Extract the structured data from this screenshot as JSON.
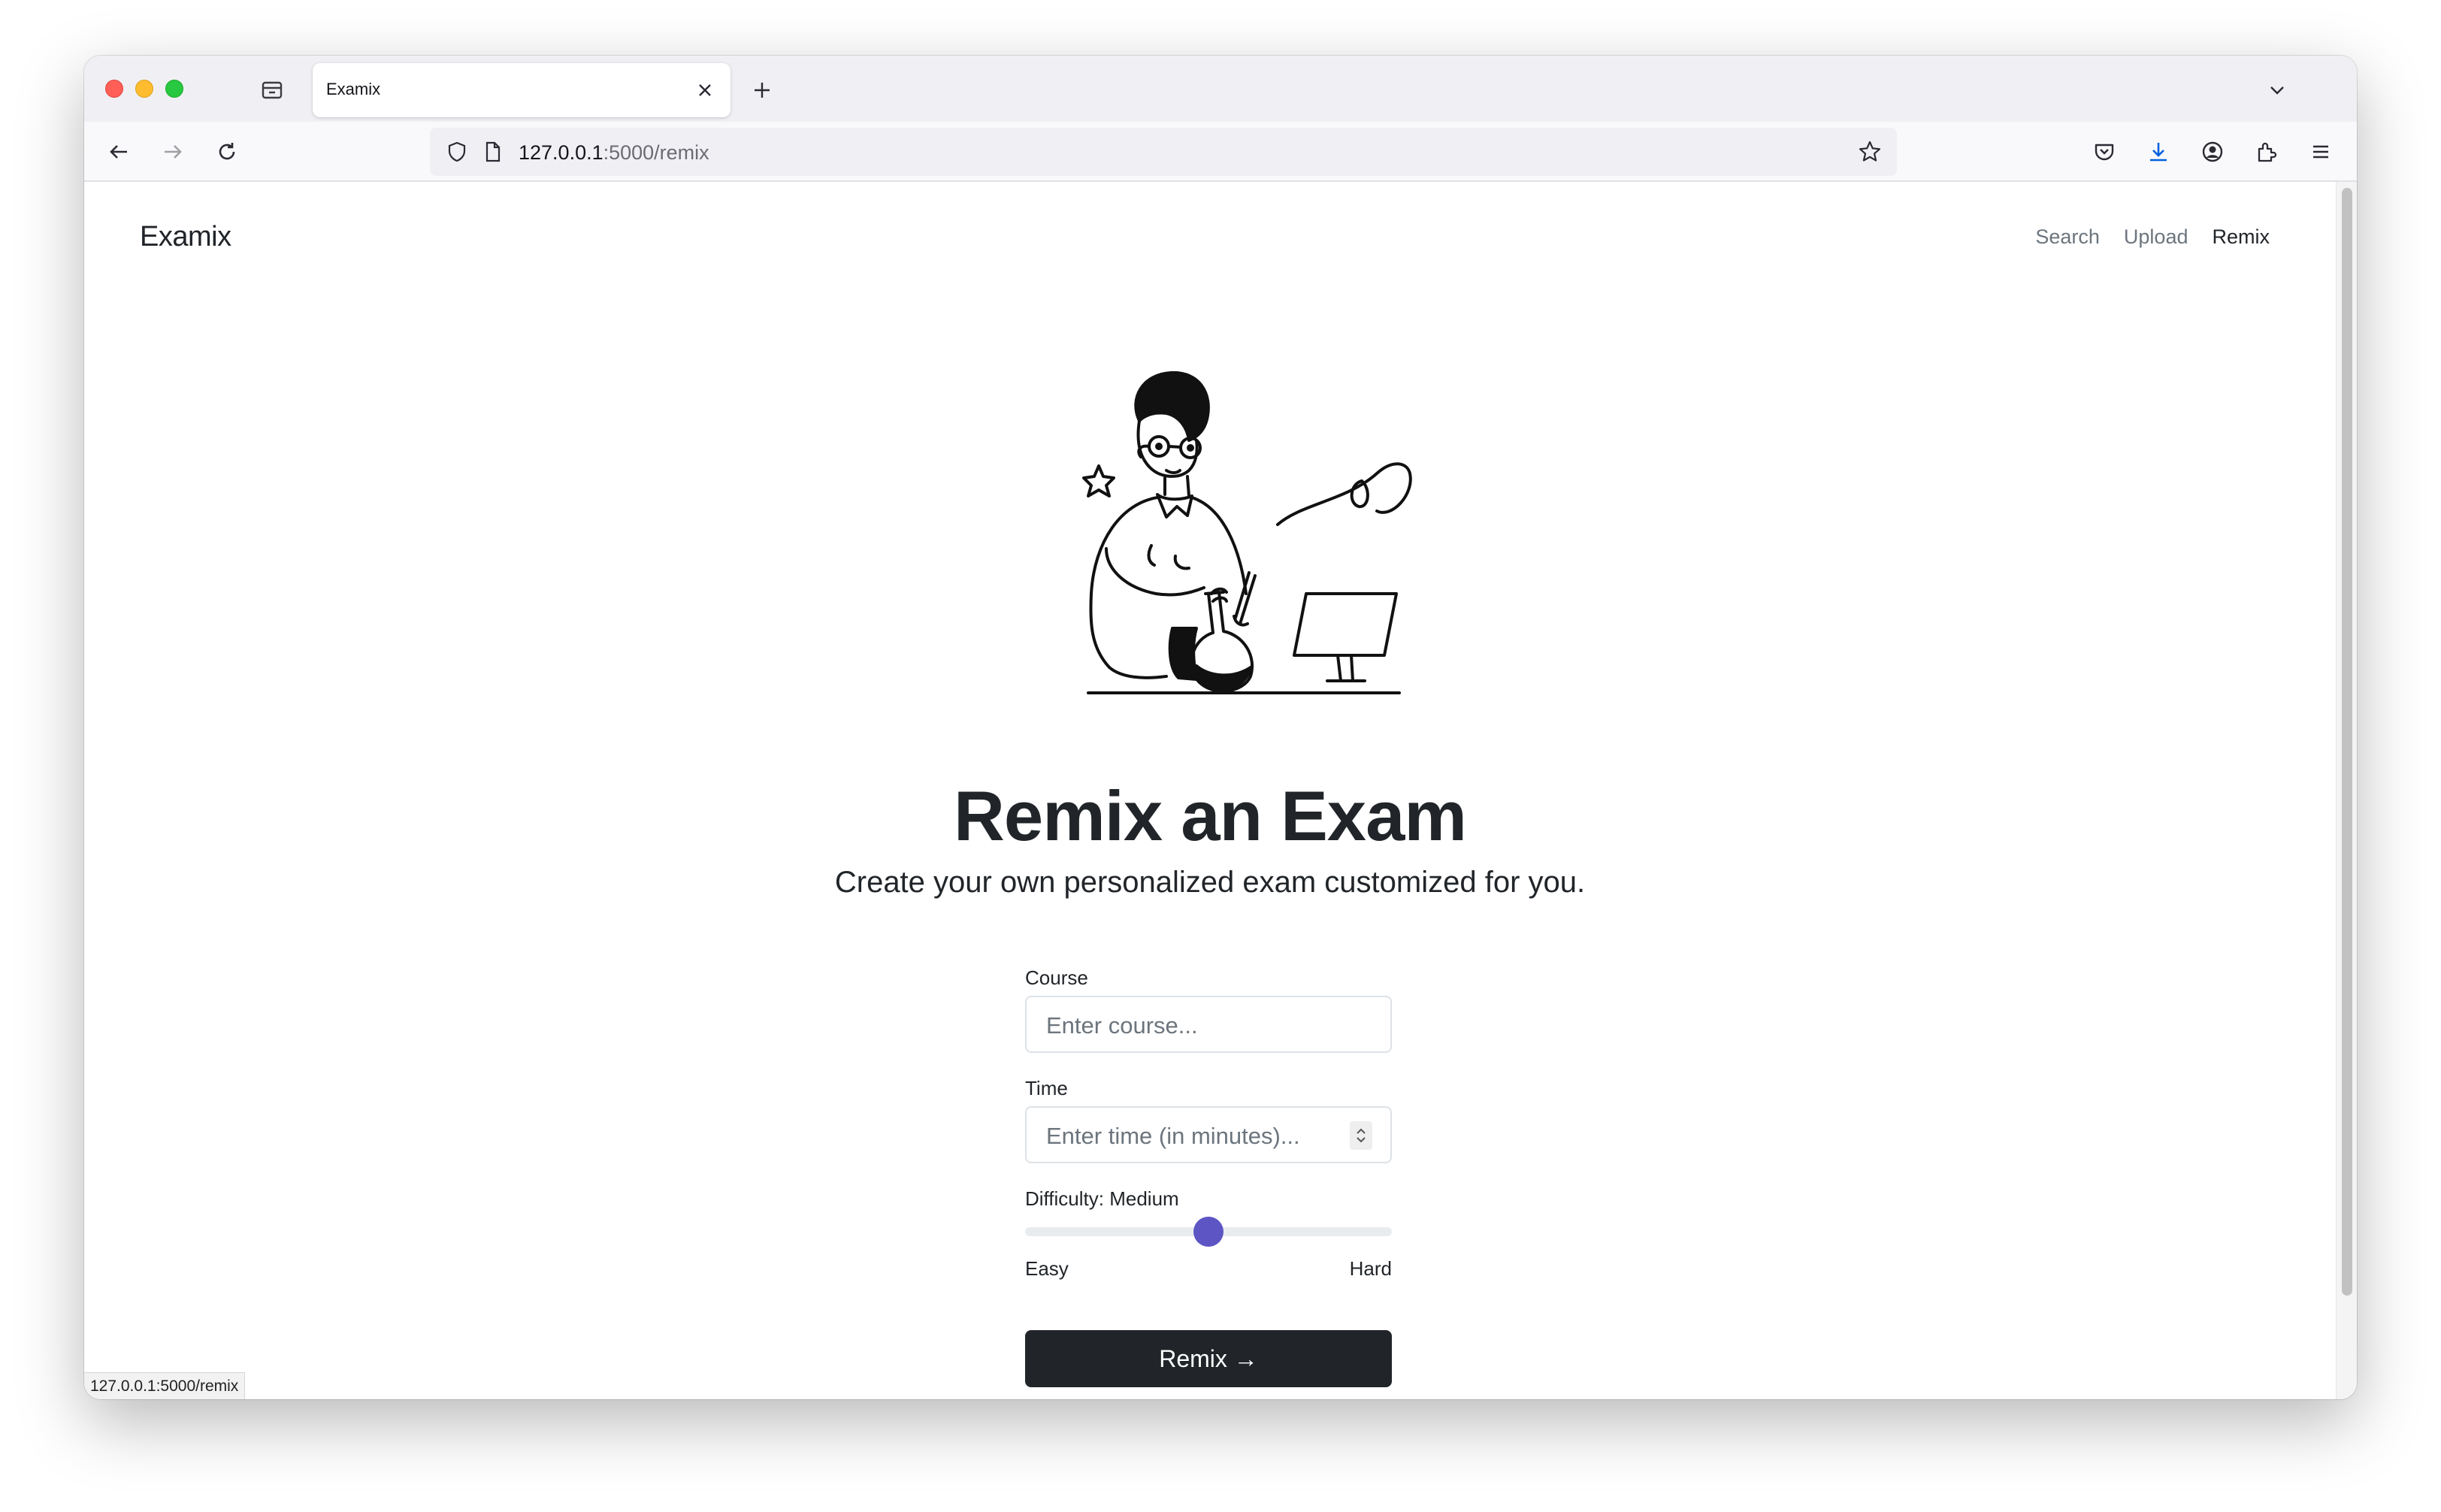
{
  "browser": {
    "tab_title": "Examix",
    "url_host": "127.0.0.1",
    "url_rest": ":5000/remix",
    "status_url": "127.0.0.1:5000/remix"
  },
  "site": {
    "brand": "Examix",
    "nav": [
      {
        "label": "Search",
        "active": false
      },
      {
        "label": "Upload",
        "active": false
      },
      {
        "label": "Remix",
        "active": true
      }
    ]
  },
  "hero": {
    "title": "Remix an Exam",
    "subtitle": "Create your own personalized exam customized for you."
  },
  "form": {
    "course_label": "Course",
    "course_placeholder": "Enter course...",
    "time_label": "Time",
    "time_placeholder": "Enter time (in minutes)...",
    "difficulty_label": "Difficulty: Medium",
    "difficulty_value": 0.5,
    "easy_label": "Easy",
    "hard_label": "Hard",
    "submit_label": "Remix →"
  },
  "colors": {
    "accent": "#5c55c3",
    "button": "#212529"
  }
}
